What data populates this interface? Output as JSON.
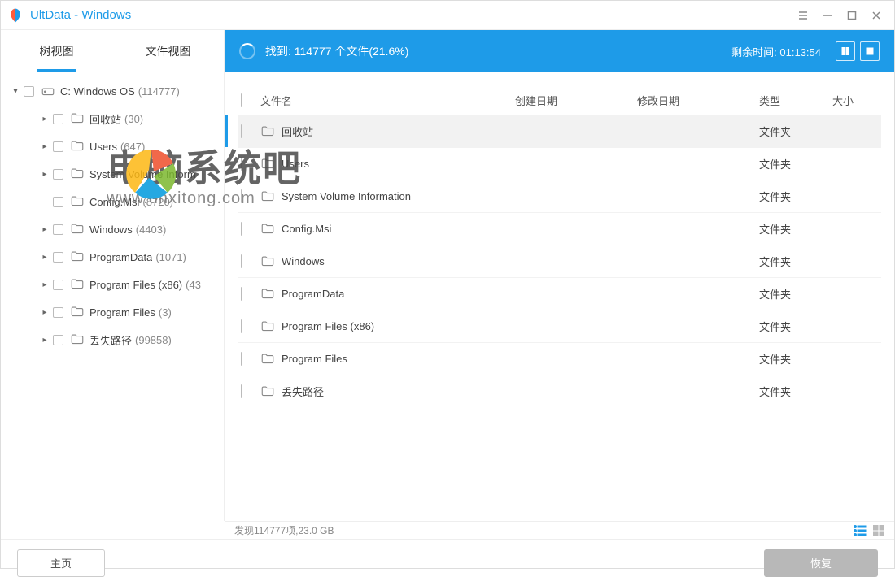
{
  "app": {
    "title": "UltData - Windows"
  },
  "sidebar": {
    "tabs": [
      {
        "label": "树视图",
        "active": true
      },
      {
        "label": "文件视图",
        "active": false
      }
    ],
    "root": {
      "label": "C: Windows OS",
      "count": "(114777)"
    },
    "items": [
      {
        "label": "回收站",
        "count": "(30)",
        "hasChildren": true
      },
      {
        "label": "Users",
        "count": "(647)",
        "hasChildren": true
      },
      {
        "label": "System Volume Inform",
        "count": "",
        "hasChildren": true
      },
      {
        "label": "Config.Msi",
        "count": "(8720)",
        "hasChildren": false
      },
      {
        "label": "Windows",
        "count": "(4403)",
        "hasChildren": true
      },
      {
        "label": "ProgramData",
        "count": "(1071)",
        "hasChildren": true
      },
      {
        "label": "Program Files (x86)",
        "count": "(43",
        "hasChildren": true
      },
      {
        "label": "Program Files",
        "count": "(3)",
        "hasChildren": true
      },
      {
        "label": "丢失路径",
        "count": "(99858)",
        "hasChildren": true
      }
    ]
  },
  "scan": {
    "status": "找到: 114777 个文件(21.6%)",
    "remaining_label": "剩余时间:",
    "remaining_value": "01:13:54"
  },
  "columns": {
    "name": "文件名",
    "cdate": "创建日期",
    "mdate": "修改日期",
    "type": "类型",
    "size": "大小"
  },
  "rows": [
    {
      "name": "回收站",
      "type": "文件夹",
      "selected": true
    },
    {
      "name": "Users",
      "type": "文件夹",
      "selected": false
    },
    {
      "name": "System Volume Information",
      "type": "文件夹",
      "selected": false
    },
    {
      "name": "Config.Msi",
      "type": "文件夹",
      "selected": false
    },
    {
      "name": "Windows",
      "type": "文件夹",
      "selected": false
    },
    {
      "name": "ProgramData",
      "type": "文件夹",
      "selected": false
    },
    {
      "name": "Program Files (x86)",
      "type": "文件夹",
      "selected": false
    },
    {
      "name": "Program Files",
      "type": "文件夹",
      "selected": false
    },
    {
      "name": "丢失路径",
      "type": "文件夹",
      "selected": false
    }
  ],
  "status": {
    "text": "发现114777项,23.0 GB"
  },
  "footer": {
    "home": "主页",
    "recover": "恢复"
  },
  "watermark": {
    "title": "电脑系统吧",
    "sub": "www.dnxitong.com"
  }
}
